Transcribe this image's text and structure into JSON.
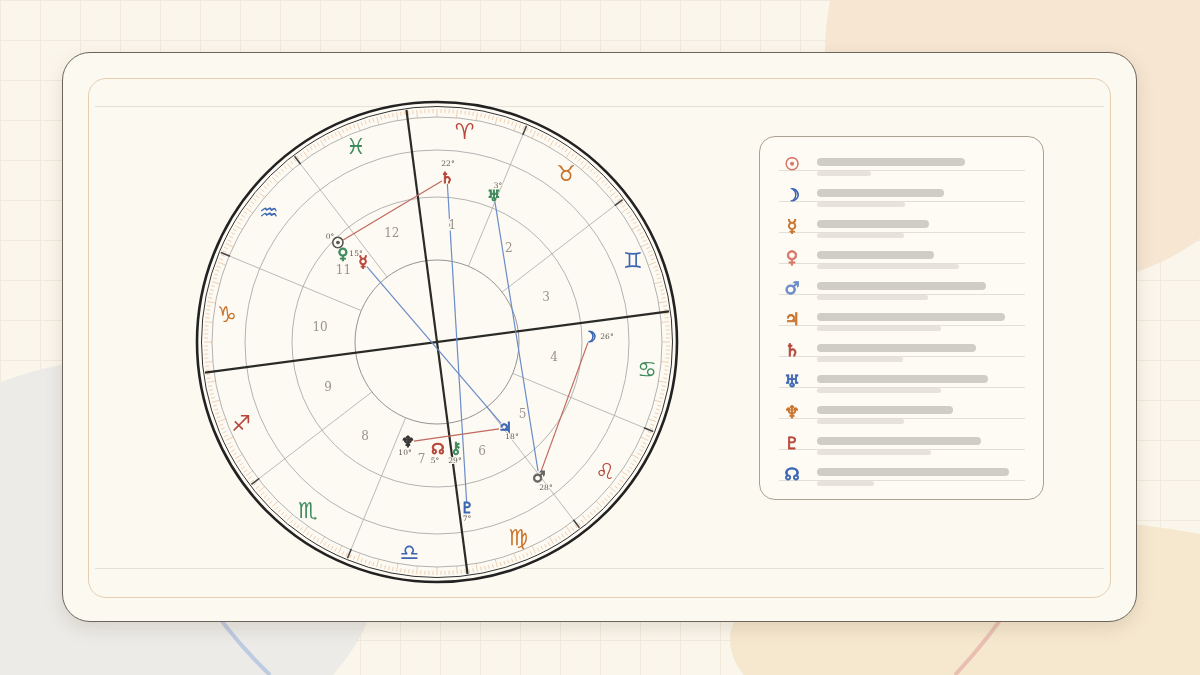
{
  "chart": {
    "signs": [
      {
        "glyph": "♈",
        "color": "#b8473b"
      },
      {
        "glyph": "♉",
        "color": "#c9742c"
      },
      {
        "glyph": "♊",
        "color": "#3c66b2"
      },
      {
        "glyph": "♋",
        "color": "#3d8a5c"
      },
      {
        "glyph": "♌",
        "color": "#b8473b"
      },
      {
        "glyph": "♍",
        "color": "#c9742c"
      },
      {
        "glyph": "♎",
        "color": "#3c66b2"
      },
      {
        "glyph": "♏",
        "color": "#3d8a5c"
      },
      {
        "glyph": "♐",
        "color": "#b8473b"
      },
      {
        "glyph": "♑",
        "color": "#c9742c"
      },
      {
        "glyph": "♒",
        "color": "#3c66b2"
      },
      {
        "glyph": "♓",
        "color": "#3d8a5c"
      }
    ],
    "houses": [
      "1",
      "2",
      "3",
      "4",
      "5",
      "6",
      "7",
      "8",
      "9",
      "10",
      "11",
      "12"
    ],
    "planets": [
      {
        "glyph": "♄",
        "degree": "22°",
        "color": "#b8473b"
      },
      {
        "glyph": "♅",
        "degree": "3°",
        "color": "#3d8a5c"
      },
      {
        "glyph": "☉",
        "degree": "0°",
        "color": "#555550"
      },
      {
        "glyph": "♀",
        "color": "#3d8a5c"
      },
      {
        "glyph": "☿",
        "degree": "15°",
        "color": "#b8473b"
      },
      {
        "glyph": "☽",
        "degree": "26°",
        "color": "#3c66b2"
      },
      {
        "glyph": "♃",
        "degree": "18°",
        "color": "#3c66b2"
      },
      {
        "glyph": "♂",
        "degree": "28°",
        "color": "#666660"
      },
      {
        "glyph": "♆",
        "degree": "10°",
        "color": "#333330"
      },
      {
        "glyph": "☊",
        "degree": "5°",
        "color": "#b8473b"
      },
      {
        "glyph": "⚷",
        "degree": "29°",
        "color": "#3d8a5c"
      },
      {
        "glyph": "♇",
        "degree": "7°",
        "color": "#3c66b2"
      }
    ]
  },
  "legend": [
    {
      "glyph": "☉",
      "color": "#d9776a"
    },
    {
      "glyph": "☽",
      "color": "#3c66b2"
    },
    {
      "glyph": "☿",
      "color": "#c9742c"
    },
    {
      "glyph": "♀",
      "color": "#d9776a"
    },
    {
      "glyph": "♂",
      "color": "#6a8cc8"
    },
    {
      "glyph": "♃",
      "color": "#c9742c"
    },
    {
      "glyph": "♄",
      "color": "#b8473b"
    },
    {
      "glyph": "♅",
      "color": "#3c66b2"
    },
    {
      "glyph": "♆",
      "color": "#c9742c"
    },
    {
      "glyph": "♇",
      "color": "#b8473b"
    },
    {
      "glyph": "☊",
      "color": "#3c66b2"
    }
  ]
}
